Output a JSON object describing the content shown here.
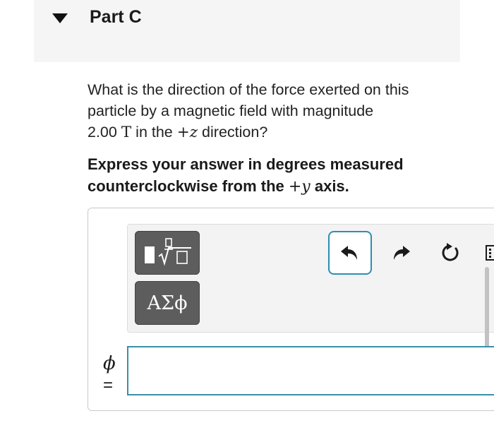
{
  "part": {
    "title": "Part C",
    "toggle_icon": "triangle-down-icon"
  },
  "question": {
    "line1": "What is the direction of the force exerted on this",
    "line2": "particle by a magnetic field with magnitude",
    "value": "2.00",
    "unit": "T",
    "mid": " in the ",
    "direction": "+z",
    "end": " direction?"
  },
  "instruction": {
    "line1": "Express your answer in degrees measured",
    "line2_pre": "counterclockwise from the ",
    "axis": "+y",
    "line2_post": " axis."
  },
  "toolbar": {
    "templates_icon": "fraction-sqrt-template-icon",
    "greek_label": "ΑΣϕ",
    "undo_icon": "undo-icon",
    "redo_icon": "redo-icon",
    "reset_icon": "reset-icon",
    "keyboard_icon": "keyboard-icon"
  },
  "answer": {
    "variable": "ϕ",
    "equals": "=",
    "value": ""
  },
  "colors": {
    "header_bg": "#f5f5f5",
    "accent": "#2d8fb0",
    "button_dark": "#5d5d5d"
  }
}
